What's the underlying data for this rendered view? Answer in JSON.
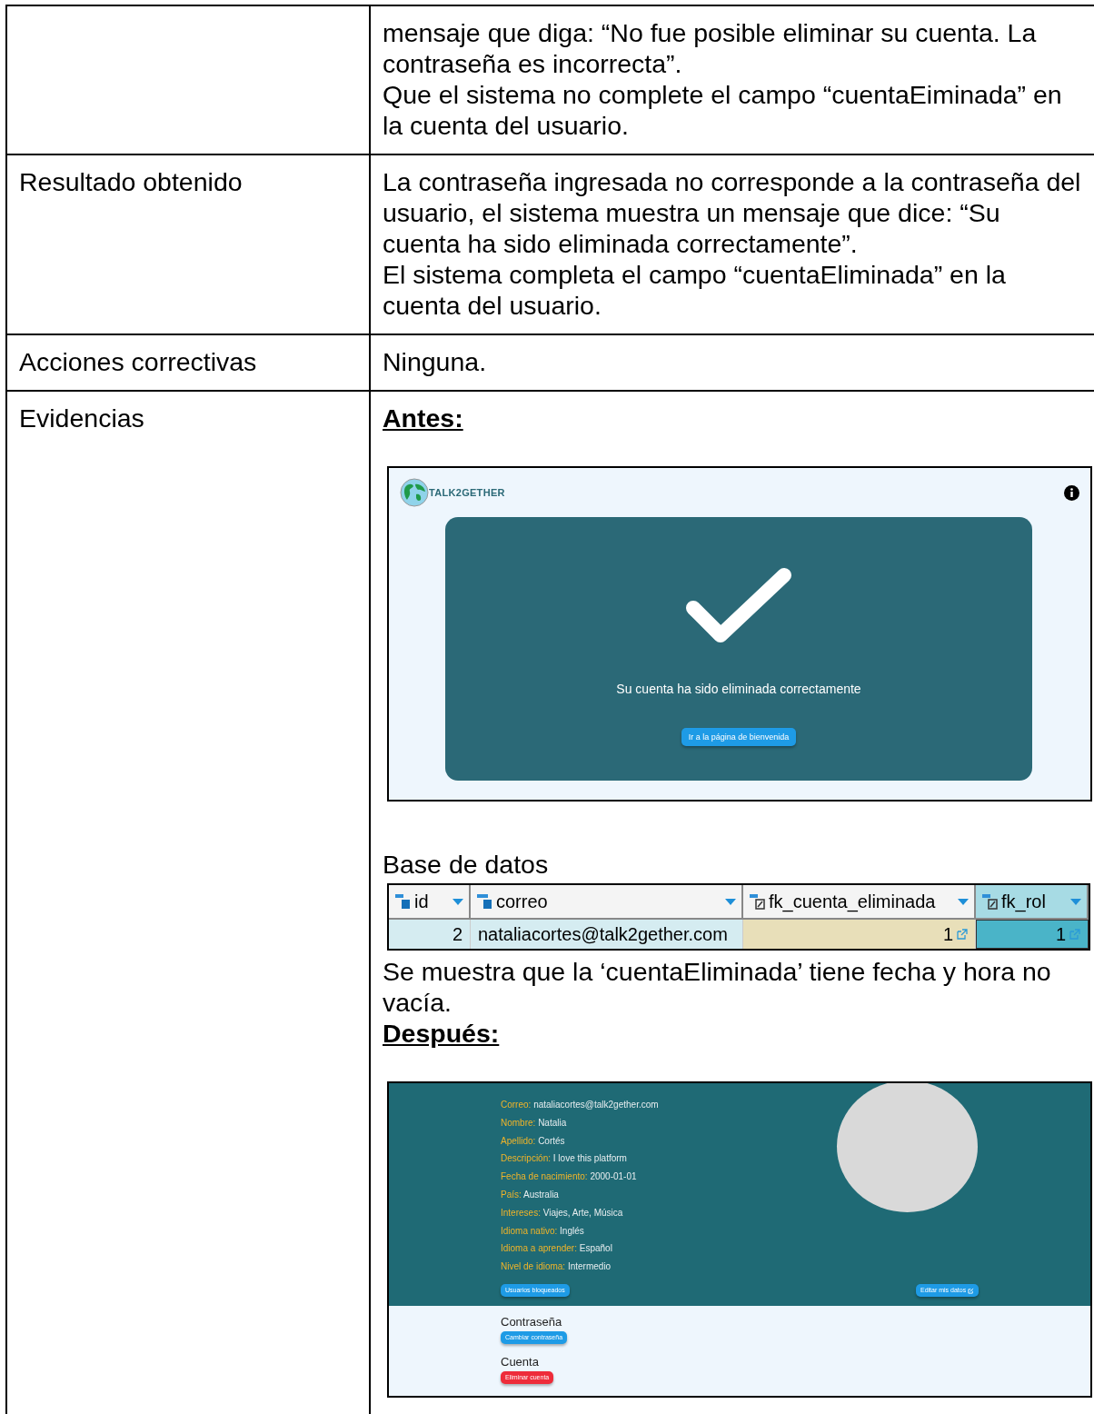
{
  "table": {
    "rows": [
      {
        "label": "",
        "paragraphs": [
          "mensaje que diga: “No fue posible eliminar su cuenta. La contraseña es incorrecta”.",
          "Que el sistema no complete el campo “cuentaEiminada” en la cuenta del usuario."
        ]
      },
      {
        "label": "Resultado obtenido",
        "paragraphs": [
          "La contraseña ingresada no corresponde a la contraseña del usuario, el sistema muestra un mensaje que dice: “Su cuenta ha sido eliminada correctamente”.",
          "El sistema completa el campo “cuentaEliminada” en la cuenta del usuario."
        ]
      },
      {
        "label": "Acciones correctivas",
        "paragraphs": [
          "Ninguna."
        ]
      },
      {
        "label": "Evidencias",
        "blocks": [
          {
            "kind": "heading",
            "text": "Antes:"
          },
          {
            "kind": "success_screen",
            "brand": "TALK2GETHER",
            "message": "Su cuenta ha sido eliminada correctamente",
            "button": "Ir a la página de bienvenida"
          },
          {
            "kind": "paragraph",
            "text": "Base de datos"
          },
          {
            "kind": "db_table",
            "columns": [
              {
                "name": "id",
                "kind": "number",
                "selected": false
              },
              {
                "name": "correo",
                "kind": "text",
                "selected": false
              },
              {
                "name": "fk_cuenta_eliminada",
                "kind": "reference",
                "selected": false
              },
              {
                "name": "fk_rol",
                "kind": "reference",
                "selected": true
              }
            ],
            "rows": [
              [
                "2",
                "nataliacortes@talk2gether.com",
                "1",
                "1"
              ]
            ]
          },
          {
            "kind": "paragraph",
            "text": "Se muestra que la ‘cuentaEliminada’ tiene fecha y hora no vacía."
          },
          {
            "kind": "heading",
            "text": "Después:"
          },
          {
            "kind": "profile_screen",
            "fields": [
              {
                "label": "Correo:",
                "value": "nataliacortes@talk2gether.com"
              },
              {
                "label": "Nombre:",
                "value": "Natalia"
              },
              {
                "label": "Apellido:",
                "value": "Cortés"
              },
              {
                "label": "Descripción:",
                "value": "I love this platform"
              },
              {
                "label": "Fecha de nacimiento:",
                "value": "2000-01-01"
              },
              {
                "label": "País:",
                "value": "Australia"
              },
              {
                "label": "Intereses:",
                "value": "Viajes, Arte, Música"
              },
              {
                "label": "Idioma nativo:",
                "value": "Inglés"
              },
              {
                "label": "Idioma a aprender:",
                "value": "Español"
              },
              {
                "label": "Nivel de idioma:",
                "value": "Intermedio"
              }
            ],
            "blocked_button": "Usuarios bloqueados",
            "edit_button": "Editar mis datos",
            "sections": [
              {
                "title": "Contraseña",
                "button": "Cambiar contraseña",
                "kind": "primary"
              },
              {
                "title": "Cuenta",
                "button": "Eliminar cuenta",
                "kind": "danger"
              }
            ]
          }
        ]
      }
    ]
  }
}
